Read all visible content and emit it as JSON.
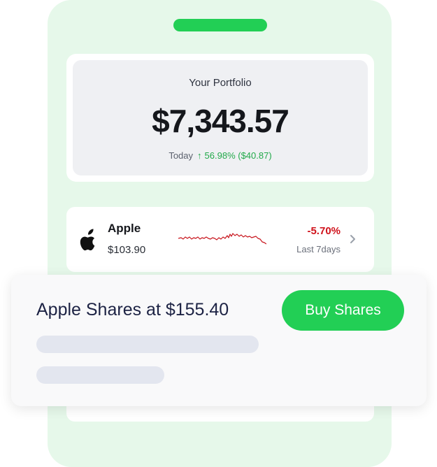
{
  "colors": {
    "accent_green": "#22cf55",
    "positive_green": "#22a94a",
    "negative_red": "#d0121b",
    "phone_background": "#e6f8ea"
  },
  "portfolio": {
    "title": "Your Portfolio",
    "value": "$7,343.57",
    "period_label": "Today",
    "change_icon": "arrow-up-icon",
    "change_text": "56.98% ($40.87)"
  },
  "stock": {
    "logo_icon": "apple-logo-icon",
    "name": "Apple",
    "price": "$103.90",
    "change": "-5.70%",
    "period": "Last 7days",
    "chevron_icon": "chevron-right-icon"
  },
  "popup": {
    "title": "Apple Shares at $155.40",
    "button_label": "Buy Shares"
  }
}
